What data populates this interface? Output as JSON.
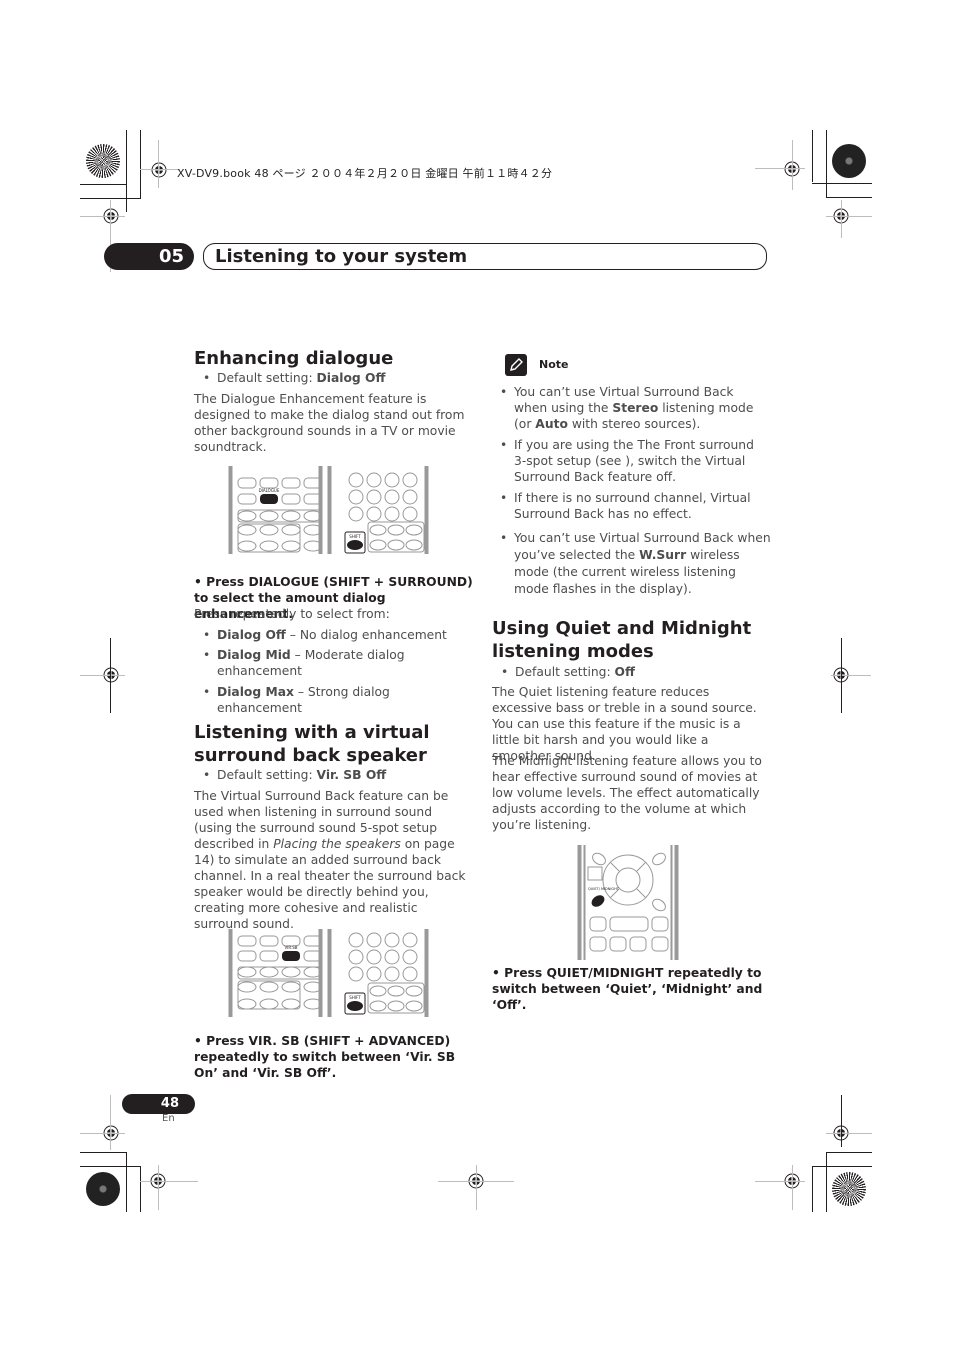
{
  "print_meta": "XV-DV9.book 48 ページ ２００４年２月２０日 金曜日 午前１１時４２分",
  "header": {
    "chapter_number": "05",
    "chapter_title": "Listening to your system"
  },
  "left_column": {
    "enhancing": {
      "heading": "Enhancing dialogue",
      "default_prefix": "Default setting: ",
      "default_value": "Dialog Off",
      "body": "The Dialogue Enhancement feature is designed to make the dialog stand out from other background sounds in a TV or movie soundtrack.",
      "remote_labels": {
        "highlight": "DIALOGUE",
        "shift": "SHIFT"
      },
      "instruction": "•    Press DIALOGUE (SHIFT + SURROUND) to select the amount dialog enhancement.",
      "instruction_sub": "Press repeatedly to select from:",
      "options": [
        {
          "name": "Dialog Off",
          "desc": " – No dialog enhancement"
        },
        {
          "name": "Dialog Mid",
          "desc": " – Moderate dialog enhancement"
        },
        {
          "name": "Dialog Max",
          "desc": " – Strong dialog enhancement"
        }
      ]
    },
    "virtual": {
      "heading_line1": "Listening with a virtual",
      "heading_line2": "surround back speaker",
      "default_prefix": "Default setting: ",
      "default_value": "Vir. SB Off",
      "body_part1": "The Virtual Surround Back feature can be used when listening in surround sound (using the surround sound 5-spot setup described in ",
      "body_italic": "Placing the speakers",
      "body_part2": " on page 14) to simulate an added surround back channel. In a real theater the surround back speaker would be directly behind you, creating more cohesive and realistic surround sound.",
      "remote_labels": {
        "highlight": "VIR.SB",
        "shift": "SHIFT"
      },
      "instruction": "•    Press VIR. SB (SHIFT + ADVANCED) repeatedly to switch between ‘Vir. SB On’ and ‘Vir. SB Off’."
    }
  },
  "right_column": {
    "note": {
      "label": "Note",
      "items": [
        {
          "pre": "You can’t use Virtual Surround Back when using the ",
          "b1": "Stereo",
          "mid": " listening mode (or ",
          "b2": "Auto",
          "post": " with stereo sources)."
        },
        {
          "text": "If you are using the The Front surround 3-spot setup (see ), switch the  Virtual Surround Back feature off."
        },
        {
          "text": "If there is no surround channel, Virtual Surround Back has no effect."
        },
        {
          "pre": "You can’t use Virtual Surround Back when you’ve selected the ",
          "b1": "W.Surr",
          "post": " wireless mode (the current wireless listening mode flashes in the display)."
        }
      ]
    },
    "quiet": {
      "heading_line1": "Using Quiet and Midnight",
      "heading_line2": "listening modes",
      "default_prefix": "Default setting: ",
      "default_value": "Off",
      "body1": "The Quiet listening feature reduces excessive bass or treble in a sound source. You can use this feature if the music is a little bit harsh and you would like a smoother sound.",
      "body2": "The Midnight listening feature allows you to hear effective surround sound of movies at low volume levels. The effect automatically adjusts according to the volume at which you’re listening.",
      "remote_labels": {
        "highlight": "QUIET/ MIDNIGHT"
      },
      "instruction": "•    Press QUIET/MIDNIGHT repeatedly to switch between ‘Quiet’, ‘Midnight’ and ‘Off’."
    }
  },
  "footer": {
    "page_number": "48",
    "language": "En"
  }
}
